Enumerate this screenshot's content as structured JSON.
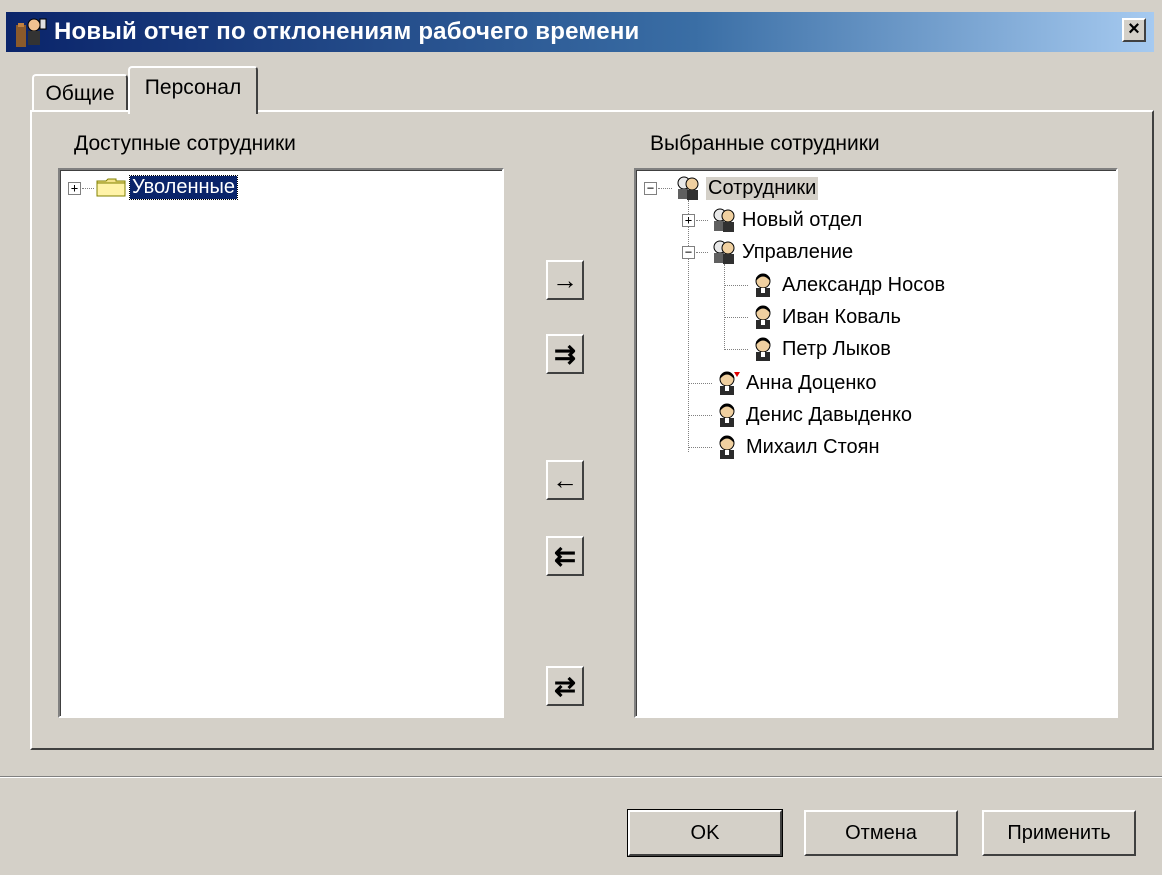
{
  "window": {
    "title": "Новый отчет по отклонениям рабочего времени",
    "close_label": "×"
  },
  "tabs": [
    {
      "label": "Общие",
      "active": false
    },
    {
      "label": "Персонал",
      "active": true
    }
  ],
  "available": {
    "label": "Доступные сотрудники",
    "items": [
      {
        "label": "Уволенные",
        "type": "folder",
        "expanded": false,
        "selected": true
      }
    ]
  },
  "selected": {
    "label": "Выбранные сотрудники",
    "root": "Сотрудники",
    "groups": [
      {
        "label": "Новый отдел",
        "expanded": false
      },
      {
        "label": "Управление",
        "expanded": true,
        "members": [
          "Александр Носов",
          "Иван Коваль",
          "Петр Лыков"
        ]
      }
    ],
    "people": [
      "Анна Доценко",
      "Денис Давыденко",
      "Михаил Стоян"
    ]
  },
  "move_buttons": {
    "add_one": "→",
    "add_all": "⇉",
    "remove_one": "←",
    "remove_all": "⇇",
    "swap": "⇄"
  },
  "buttons": {
    "ok": "OK",
    "cancel": "Отмена",
    "apply": "Применить"
  },
  "colors": {
    "titlebar_start": "#0a246a",
    "titlebar_end": "#a6caf0",
    "selection": "#0a246a",
    "face": "#d4d0c8"
  }
}
